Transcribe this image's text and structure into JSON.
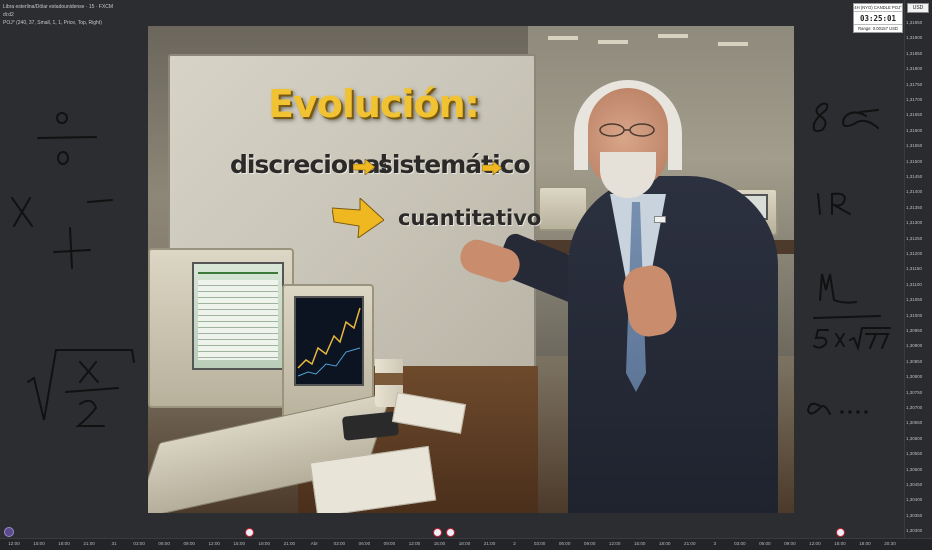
{
  "legend": {
    "line1": "Libra esterlina/Dólar estadounidense · 15 · FXCM",
    "line2": "di:d2",
    "line3": "POJ° (240, 37, Small, 1, 1, Price, Top, Right)"
  },
  "candle_widget": {
    "header": "4H (NYO) CANDLE POJ°",
    "countdown": "03:25:01",
    "range": "Range: 0.00157 USD"
  },
  "currency_button": "USD",
  "price_ticks": [
    "1,31950",
    "1,31900",
    "1,31850",
    "1,31800",
    "1,31750",
    "1,31700",
    "1,31650",
    "1,31600",
    "1,31550",
    "1,31500",
    "1,31450",
    "1,31400",
    "1,31350",
    "1,31300",
    "1,31250",
    "1,31200",
    "1,31150",
    "1,31100",
    "1,31050",
    "1,31000",
    "1,30950",
    "1,30900",
    "1,30850",
    "1,30800",
    "1,30750",
    "1,30700",
    "1,30650",
    "1,30600",
    "1,30550",
    "1,30500",
    "1,30450",
    "1,30400",
    "1,30350",
    "1,30300"
  ],
  "time_ticks": [
    "12:00",
    "15:00",
    "18:00",
    "21:00",
    "31",
    "03:00",
    "06:00",
    "09:00",
    "12:00",
    "15:00",
    "18:00",
    "21:00",
    "Abr",
    "03:00",
    "06:00",
    "09:00",
    "12:00",
    "15:00",
    "18:00",
    "21:00",
    "2",
    "03:00",
    "06:00",
    "09:00",
    "12:00",
    "15:00",
    "18:00",
    "21:00",
    "3",
    "03:00",
    "06:00",
    "09:00",
    "12:00",
    "15:00",
    "18:00",
    "20:30"
  ],
  "photo": {
    "title": "Evolución:",
    "step1": "discrecional",
    "step2": "sistemático",
    "step3": "cuantitativo"
  },
  "colors": {
    "background": "#2c2d31",
    "title_yellow": "#f1c232",
    "arrow_yellow": "#f0b820",
    "ink": "#111111"
  },
  "icons": [
    "tradingview-logo-icon",
    "economic-event-flag-icon"
  ]
}
